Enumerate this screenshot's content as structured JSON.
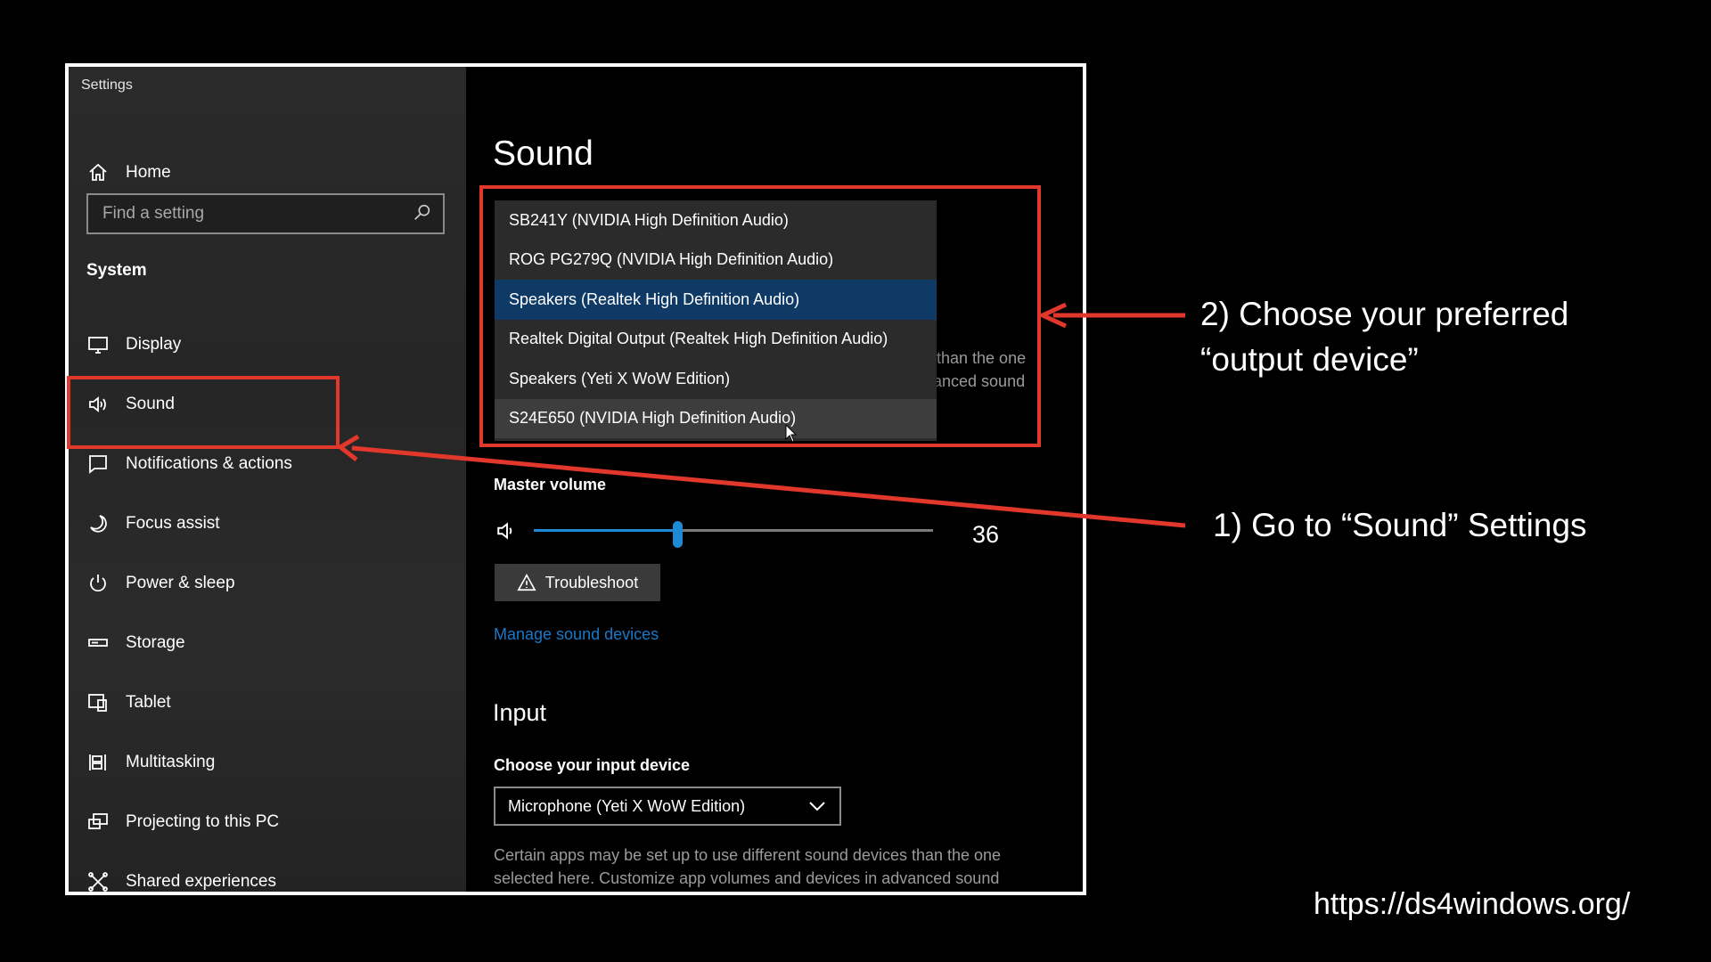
{
  "window": {
    "title": "Settings"
  },
  "sidebar": {
    "home": "Home",
    "search_placeholder": "Find a setting",
    "section": "System",
    "items": [
      {
        "label": "Display",
        "icon": "display-icon"
      },
      {
        "label": "Sound",
        "icon": "speaker-icon"
      },
      {
        "label": "Notifications & actions",
        "icon": "notification-icon"
      },
      {
        "label": "Focus assist",
        "icon": "moon-icon"
      },
      {
        "label": "Power & sleep",
        "icon": "power-icon"
      },
      {
        "label": "Storage",
        "icon": "storage-icon"
      },
      {
        "label": "Tablet",
        "icon": "tablet-icon"
      },
      {
        "label": "Multitasking",
        "icon": "multitasking-icon"
      },
      {
        "label": "Projecting to this PC",
        "icon": "projecting-icon"
      },
      {
        "label": "Shared experiences",
        "icon": "shared-experiences-icon"
      }
    ]
  },
  "main": {
    "title": "Sound",
    "output_dropdown": {
      "options": [
        "SB241Y (NVIDIA High Definition Audio)",
        "ROG PG279Q (NVIDIA High Definition Audio)",
        "Speakers (Realtek High Definition Audio)",
        "Realtek Digital Output (Realtek High Definition Audio)",
        "Speakers (Yeti X WoW Edition)",
        "S24E650 (NVIDIA High Definition Audio)"
      ],
      "selected": "Speakers (Realtek High Definition Audio)",
      "hovered": "S24E650 (NVIDIA High Definition Audio)"
    },
    "partial_text": [
      "than the one",
      "anced sound"
    ],
    "master_volume_label": "Master volume",
    "volume": 36,
    "volume_text": "36",
    "troubleshoot_label": "Troubleshoot",
    "manage_link": "Manage sound devices",
    "input_heading": "Input",
    "input_device_label": "Choose your input device",
    "input_device_value": "Microphone (Yeti X WoW Edition)",
    "input_description": "Certain apps may be set up to use different sound devices than the one selected here. Customize app volumes and devices in advanced sound"
  },
  "annotations": {
    "step2_line1": "2) Choose your preferred",
    "step2_line2": "“output device”",
    "step1": "1) Go to “Sound” Settings",
    "url": "https://ds4windows.org/"
  },
  "colors": {
    "highlight": "#e2372b",
    "accent": "#1e8ad6",
    "selected_item": "#0f3a66",
    "link": "#1a78c9"
  }
}
